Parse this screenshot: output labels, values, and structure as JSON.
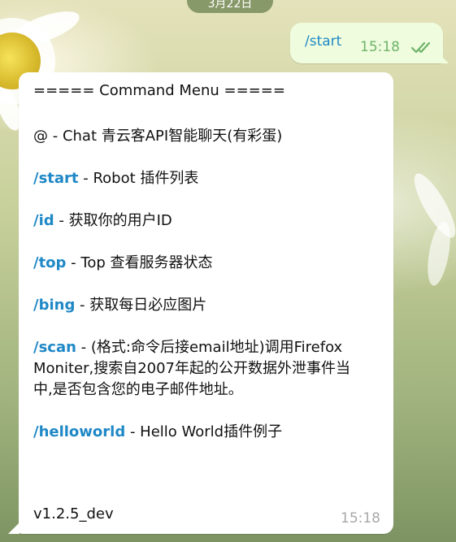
{
  "date_pill": "3月22日",
  "outgoing": {
    "text": "/start",
    "time": "15:18",
    "status_icon": "double-check-icon"
  },
  "incoming": {
    "header": "===== Command Menu =====",
    "chat_line": "@ - Chat 青云客API智能聊天(有彩蛋)",
    "commands": [
      {
        "cmd": "/start",
        "desc": " - Robot 插件列表"
      },
      {
        "cmd": "/id",
        "desc": " - 获取你的用户ID"
      },
      {
        "cmd": "/top",
        "desc": " - Top 查看服务器状态"
      },
      {
        "cmd": "/bing",
        "desc": " - 获取每日必应图片"
      },
      {
        "cmd": "/scan",
        "desc": " - (格式:命令后接email地址)调用Firefox"
      },
      {
        "cmd": "/helloworld",
        "desc": " - Hello World插件例子"
      }
    ],
    "scan_continued_1": "Moniter,搜索自2007年起的公开数据外泄事件当",
    "scan_continued_2": "中,是否包含您的电子邮件地址。",
    "version": "v1.2.5_dev",
    "time": "15:18"
  },
  "colors": {
    "link": "#1f88c6",
    "outgoing_bg": "#effdde",
    "outgoing_time": "#6fb36a"
  }
}
